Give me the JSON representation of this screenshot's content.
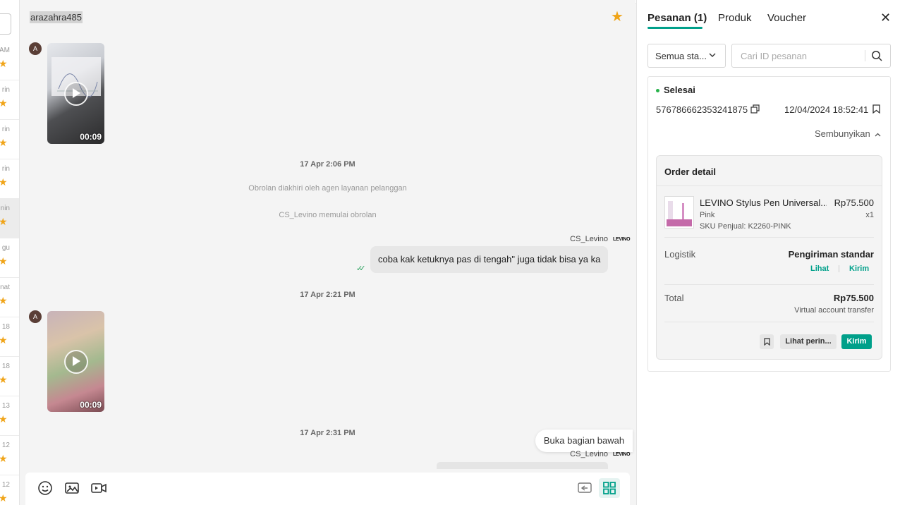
{
  "left_list": {
    "items": [
      {
        "time": "AM",
        "active": false
      },
      {
        "time": "rin",
        "active": false
      },
      {
        "time": "rin",
        "active": false
      },
      {
        "time": "rin",
        "active": false
      },
      {
        "time": "nin",
        "active": true
      },
      {
        "time": "gu",
        "active": false
      },
      {
        "time": "nat",
        "active": false
      },
      {
        "time": "18",
        "active": false
      },
      {
        "time": "18",
        "active": false
      },
      {
        "time": "13",
        "active": false
      },
      {
        "time": "12",
        "active": false
      },
      {
        "time": "12",
        "active": false
      }
    ]
  },
  "chat": {
    "username": "arazahra485",
    "avatar_initial": "A",
    "messages": {
      "video1_duration": "00:09",
      "ts1": "17 Apr 2:06 PM",
      "sys1": "Obrolan diakhiri oleh agen layanan pelanggan",
      "sys2": "CS_Levino memulai obrolan",
      "agent_name": "CS_Levino",
      "agent_logo": "LEVINO",
      "bubble_text": "coba kak ketuknya pas di tengah\" juga tidak bisa ya ka",
      "ts2": "17 Apr 2:21 PM",
      "video2_duration": "00:09",
      "ts3": "17 Apr 2:31 PM",
      "agent_name_2": "CS_Levino"
    },
    "scroll_bottom_label": "Buka bagian bawah"
  },
  "panel": {
    "tabs": [
      "Pesanan (1)",
      "Produk",
      "Voucher"
    ],
    "status_filter": "Semua sta...",
    "search_placeholder": "Cari ID pesanan",
    "order": {
      "status": "Selesai",
      "order_id": "576786662353241875",
      "datetime": "12/04/2024 18:52:41",
      "toggle_label": "Sembunyikan",
      "detail_title": "Order detail",
      "product_name": "LEVINO Stylus Pen Universal...",
      "product_price": "Rp75.500",
      "product_variant": "Pink",
      "product_qty": "x1",
      "product_sku": "SKU Penjual: K2260-PINK",
      "logistics_label": "Logistik",
      "logistics_value": "Pengiriman standar",
      "logistics_link_view": "Lihat",
      "logistics_link_send": "Kirim",
      "total_label": "Total",
      "total_value": "Rp75.500",
      "payment_method": "Virtual account transfer",
      "btn_details": "Lihat perin...",
      "btn_send": "Kirim"
    }
  },
  "colors": {
    "accent": "#00a08a",
    "star": "#f0a418",
    "status_dot": "#27b24a"
  }
}
